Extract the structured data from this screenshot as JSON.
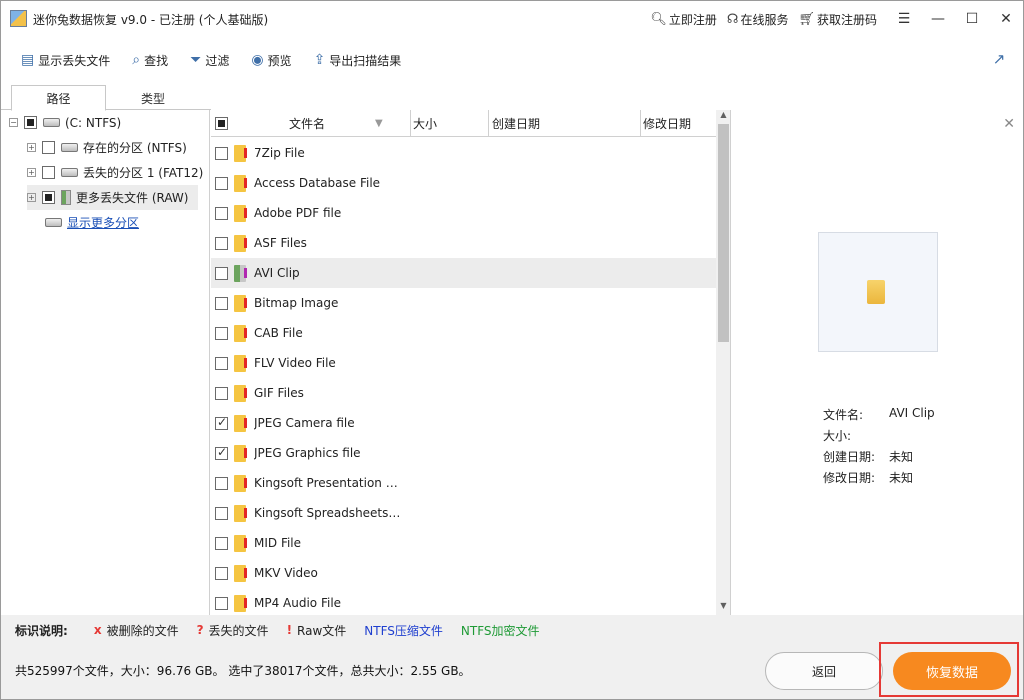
{
  "app": {
    "title": "迷你兔数据恢复 v9.0 - 已注册 (个人基础版)",
    "links": [
      {
        "label": "立即注册",
        "icon": "search-icon"
      },
      {
        "label": "在线服务",
        "icon": "support-icon"
      },
      {
        "label": "获取注册码",
        "icon": "cart-icon"
      }
    ],
    "window_buttons": [
      "menu",
      "minimize",
      "maximize",
      "close"
    ]
  },
  "toolbar": {
    "items": [
      {
        "label": "显示丢失文件",
        "icon": "show-lost-files-icon"
      },
      {
        "label": "查找",
        "icon": "search-icon"
      },
      {
        "label": "过滤",
        "icon": "filter-icon"
      },
      {
        "label": "预览",
        "icon": "eye-icon"
      },
      {
        "label": "导出扫描结果",
        "icon": "export-icon"
      }
    ]
  },
  "tabs": [
    "路径",
    "类型"
  ],
  "tree": {
    "root": "(C: NTFS)",
    "items": [
      "存在的分区 (NTFS)",
      "丢失的分区 1 (FAT12)",
      "更多丢失文件 (RAW)"
    ],
    "more_link": "显示更多分区"
  },
  "file_list": {
    "columns": [
      "文件名",
      "大小",
      "创建日期",
      "修改日期"
    ],
    "rows": [
      {
        "name": "7Zip File",
        "checked": false
      },
      {
        "name": "Access Database File",
        "checked": false
      },
      {
        "name": "Adobe PDF file",
        "checked": false
      },
      {
        "name": "ASF Files",
        "checked": false
      },
      {
        "name": "AVI Clip",
        "checked": false
      },
      {
        "name": "Bitmap Image",
        "checked": false
      },
      {
        "name": "CAB File",
        "checked": false
      },
      {
        "name": "FLV Video File",
        "checked": false
      },
      {
        "name": "GIF Files",
        "checked": false
      },
      {
        "name": "JPEG Camera file",
        "checked": true
      },
      {
        "name": "JPEG Graphics file",
        "checked": true
      },
      {
        "name": "Kingsoft Presentation Do...",
        "checked": false
      },
      {
        "name": "Kingsoft Spreadsheets File",
        "checked": false
      },
      {
        "name": "MID File",
        "checked": false
      },
      {
        "name": "MKV Video",
        "checked": false
      },
      {
        "name": "MP4 Audio File",
        "checked": false
      }
    ]
  },
  "preview": {
    "file_name_label": "文件名:",
    "file_name": "AVI Clip",
    "size_label": "大小:",
    "size": "",
    "created_label": "创建日期:",
    "created": "未知",
    "modified_label": "修改日期:",
    "modified": "未知"
  },
  "legend": {
    "title": "标识说明:",
    "items": [
      {
        "mark": "x",
        "label": "被删除的文件",
        "color": "#e53935"
      },
      {
        "mark": "?",
        "label": "丢失的文件",
        "color": "#e53935"
      },
      {
        "mark": "!",
        "label": "Raw文件",
        "color": "#e53935"
      },
      {
        "mark": "",
        "label": "NTFS压缩文件",
        "color": "#1f3fcf"
      },
      {
        "mark": "",
        "label": "NTFS加密文件",
        "color": "#1f9a36"
      }
    ]
  },
  "status": {
    "summary": "共525997个文件，大小：96.76 GB。 选中了38017个文件，总共大小：2.55 GB。",
    "back_label": "返回",
    "recover_label": "恢复数据"
  }
}
